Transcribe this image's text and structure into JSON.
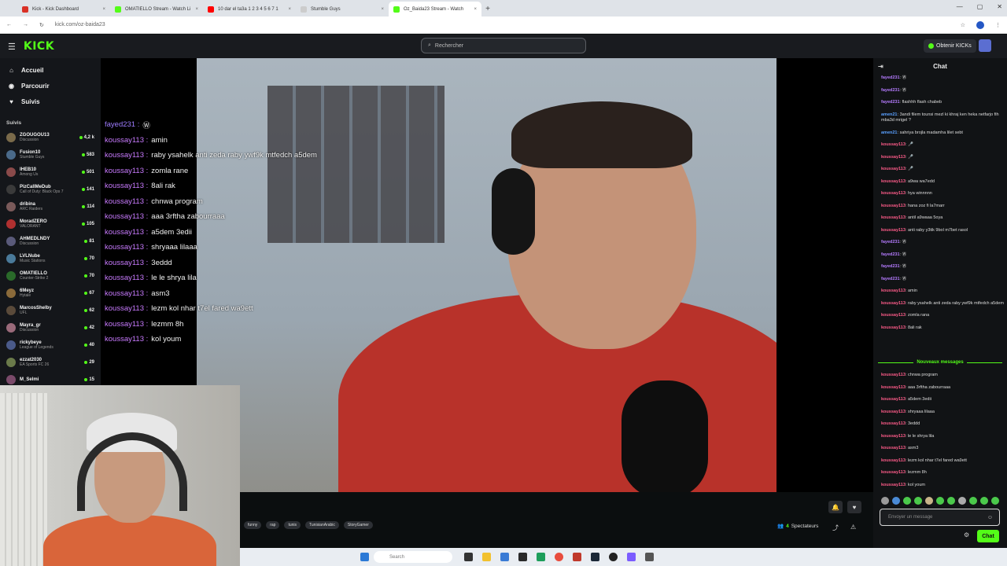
{
  "browser": {
    "tabs": [
      {
        "title": "Kick - Kick Dashboard",
        "color": "#d93025",
        "active": false
      },
      {
        "title": "OMATIELLO Stream - Watch Li",
        "color": "#53fc18",
        "active": false
      },
      {
        "title": "10 dar el ta3a 1 2 3 4 5 6 7 1",
        "color": "#ff0000",
        "active": false
      },
      {
        "title": "Stumble Guys",
        "color": "#cccccc",
        "active": false
      },
      {
        "title": "Oz_Baida23 Stream - Watch",
        "color": "#53fc18",
        "active": true
      }
    ],
    "url": "kick.com/oz-baida23"
  },
  "header": {
    "logo": "KICK",
    "search_placeholder": "Rechercher",
    "get_kicks": "Obtenir KICKs"
  },
  "sidebar": {
    "nav": [
      {
        "label": "Accueil",
        "icon": "home-icon",
        "glyph": "⌂"
      },
      {
        "label": "Parcourir",
        "icon": "compass-icon",
        "glyph": "◉"
      },
      {
        "label": "Suivis",
        "icon": "heart-icon",
        "glyph": "♥"
      }
    ],
    "followed_title": "Suivis",
    "channels": [
      {
        "name": "ZGOUGOU13",
        "category": "Discussion",
        "viewers": "4,2 k",
        "color": "#7a6a4a"
      },
      {
        "name": "Fusion10",
        "category": "Stumble Guys",
        "viewers": "583",
        "color": "#4a6a8a"
      },
      {
        "name": "IHEB10",
        "category": "Among Us",
        "viewers": "501",
        "color": "#8a4a4a"
      },
      {
        "name": "PizCallMeDub",
        "category": "Call of Duty: Black Ops 7",
        "viewers": "141",
        "color": "#3a3a3a"
      },
      {
        "name": "dribina",
        "category": "ARC Raiders",
        "viewers": "114",
        "color": "#7a5a5a"
      },
      {
        "name": "MoradZERO",
        "category": "VALORANT",
        "viewers": "105",
        "color": "#b03030"
      },
      {
        "name": "AHMEDLNDY",
        "category": "Discussion",
        "viewers": "81",
        "color": "#5a5a7a"
      },
      {
        "name": "LVLNube",
        "category": "Music Stations",
        "viewers": "70",
        "color": "#4a7a9a"
      },
      {
        "name": "OMATIELLO",
        "category": "Counter-Strike 2",
        "viewers": "70",
        "color": "#2a6a2a"
      },
      {
        "name": "6Meyz",
        "category": "Hytale",
        "viewers": "67",
        "color": "#8a6a3a"
      },
      {
        "name": "MarcosShelby",
        "category": "UFL",
        "viewers": "62",
        "color": "#5a4a3a"
      },
      {
        "name": "Mayra_gr",
        "category": "Discussion",
        "viewers": "42",
        "color": "#9a6a7a"
      },
      {
        "name": "rickybeye",
        "category": "League of Legends",
        "viewers": "40",
        "color": "#4a5a8a"
      },
      {
        "name": "ezzat2030",
        "category": "EA Sports FC 26",
        "viewers": "29",
        "color": "#6a7a4a"
      },
      {
        "name": "M_Selmi",
        "category": "",
        "viewers": "15",
        "color": "#7a4a6a"
      }
    ]
  },
  "overlay_chat": [
    {
      "user": "fayed231",
      "msg": "Ⓦ",
      "cls": "blue"
    },
    {
      "user": "koussay113",
      "msg": "amin",
      "cls": ""
    },
    {
      "user": "koussay113",
      "msg": "raby ysahelk anti zeda raby ywf9k mtfedch a5dem",
      "cls": ""
    },
    {
      "user": "koussay113",
      "msg": "zomla rane",
      "cls": ""
    },
    {
      "user": "koussay113",
      "msg": "8ali rak",
      "cls": ""
    },
    {
      "user": "koussay113",
      "msg": "chnwa program",
      "cls": ""
    },
    {
      "user": "koussay113",
      "msg": "aaa 3rftha zabourraaa",
      "cls": ""
    },
    {
      "user": "koussay113",
      "msg": "a5dem 3edii",
      "cls": ""
    },
    {
      "user": "koussay113",
      "msg": "shryaaa lilaaa",
      "cls": ""
    },
    {
      "user": "koussay113",
      "msg": "3eddd",
      "cls": ""
    },
    {
      "user": "koussay113",
      "msg": "le le shrya lila",
      "cls": ""
    },
    {
      "user": "koussay113",
      "msg": "asm3",
      "cls": ""
    },
    {
      "user": "koussay113",
      "msg": "lezm kol nhar t7el fared wa9ett",
      "cls": ""
    },
    {
      "user": "koussay113",
      "msg": "lezmm 8h",
      "cls": ""
    },
    {
      "user": "koussay113",
      "msg": "kol youm",
      "cls": ""
    }
  ],
  "stream": {
    "tags": [
      "funny",
      "rap",
      "tunis",
      "TunisianArabic",
      "StoryGamer"
    ],
    "viewers_count": "4",
    "viewers_label": "Spectateurs"
  },
  "chat": {
    "title": "Chat",
    "messages_before": [
      {
        "user": "fayed231",
        "msg": "Ⓦ",
        "c": "f"
      },
      {
        "user": "fayed231",
        "msg": "Ⓦ",
        "c": "f"
      },
      {
        "user": "fayed231",
        "msg": "flashhh flash chabeb",
        "c": "f"
      },
      {
        "user": "amen21",
        "msg": "3andi filem tounsi mezl ki khraj ken heka netfarjo fih mba3d mrigel ?",
        "c": "a"
      },
      {
        "user": "amen21",
        "msg": "sahriya brojla madamha lilet sebt",
        "c": "a"
      },
      {
        "user": "koussay113",
        "msg": "🎤",
        "c": "k"
      },
      {
        "user": "koussay113",
        "msg": "🎤",
        "c": "k"
      },
      {
        "user": "koussay113",
        "msg": "🎤",
        "c": "k"
      },
      {
        "user": "koussay113",
        "msg": "a9wa wa7edd",
        "c": "k"
      },
      {
        "user": "koussay113",
        "msg": "hya winnnnn",
        "c": "k"
      },
      {
        "user": "koussay113",
        "msg": "hana zoz fi la7marr",
        "c": "k"
      },
      {
        "user": "koussay113",
        "msg": "antil a9waaa 5oya",
        "c": "k"
      },
      {
        "user": "koussay113",
        "msg": "anti raby y3tik 9bol m7bet rasol",
        "c": "k"
      },
      {
        "user": "fayed231",
        "msg": "Ⓦ",
        "c": "f"
      },
      {
        "user": "fayed231",
        "msg": "Ⓦ",
        "c": "f"
      },
      {
        "user": "fayed231",
        "msg": "Ⓦ",
        "c": "f"
      },
      {
        "user": "fayed231",
        "msg": "Ⓦ",
        "c": "f"
      },
      {
        "user": "koussay113",
        "msg": "amin",
        "c": "k"
      },
      {
        "user": "koussay113",
        "msg": "raby ysahelk anti zeda raby ywf9k mtfedch a5dem",
        "c": "k"
      },
      {
        "user": "koussay113",
        "msg": "zomla rana",
        "c": "k"
      },
      {
        "user": "koussay113",
        "msg": "8ali rak",
        "c": "k"
      }
    ],
    "new_messages_label": "Nouveaux messages",
    "messages_after": [
      {
        "user": "koussay113",
        "msg": "chnwa program",
        "c": "k"
      },
      {
        "user": "koussay113",
        "msg": "aaa 3rftha zabourraaa",
        "c": "k"
      },
      {
        "user": "koussay113",
        "msg": "a5dem 3edii",
        "c": "k"
      },
      {
        "user": "koussay113",
        "msg": "shryaaa lilaaa",
        "c": "k"
      },
      {
        "user": "koussay113",
        "msg": "3eddd",
        "c": "k"
      },
      {
        "user": "koussay113",
        "msg": "le le shrya lila",
        "c": "k"
      },
      {
        "user": "koussay113",
        "msg": "asm3",
        "c": "k"
      },
      {
        "user": "koussay113",
        "msg": "lezm kol nhar t7el fared wa9ett",
        "c": "k"
      },
      {
        "user": "koussay113",
        "msg": "lezmm 8h",
        "c": "k"
      },
      {
        "user": "koussay113",
        "msg": "kol youm",
        "c": "k"
      }
    ],
    "input_placeholder": "Envoyer un message",
    "send_label": "Chat"
  },
  "taskbar": {
    "search_label": "Search"
  }
}
